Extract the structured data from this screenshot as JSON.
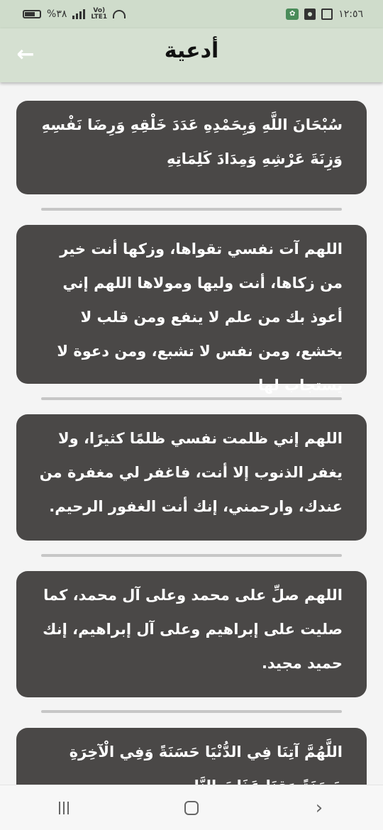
{
  "status_bar": {
    "time": "١٢:٥٦",
    "battery": "%٣٨",
    "network": "Vo) LTE1",
    "icons": [
      "battery-icon",
      "signal-icon",
      "volte-icon",
      "wifi-icon",
      "app-icon",
      "settings-icon",
      "image-icon"
    ]
  },
  "header": {
    "title": "أدعية",
    "back_icon": "arrow-left-icon"
  },
  "duas": [
    {
      "text": "سُبْحَانَ اللَّهِ وَبِحَمْدِهِ عَدَدَ خَلْقِهِ وَرِضَا نَفْسِهِ وَزِنَةَ عَرْشِهِ وَمِدَادَ كَلِمَاتِهِ"
    },
    {
      "text": "اللهم آت نفسي تقواها، وزكها أنت خير من زكاها، أنت وليها ومولاها اللهم إني أعوذ بك من علم لا ينفع ومن قلب لا يخشع، ومن نفس لا تشبع، ومن دعوة لا يستجاب لها"
    },
    {
      "text": "اللهم إني ظلمت نفسي ظلمًا كثيرًا، ولا يغفر الذنوب إلا أنت، فاغفر لي مغفرة من عندك، وارحمني، إنك أنت الغفور الرحيم."
    },
    {
      "text": "اللهم صلِّ على محمد وعلى آل محمد، كما صليت على إبراهيم وعلى آل إبراهيم، إنك حميد مجيد."
    },
    {
      "text": "اللَّهُمَّ آتِنَا فِي الدُّنْيَا حَسَنَةً وَفِي الْآخِرَةِ حَسَنَةً وَقِنَا عَذَابَ النَّارِ"
    }
  ],
  "nav_bar": {
    "recents_icon": "recents-icon",
    "home_icon": "home-icon",
    "back_icon": "back-icon"
  }
}
